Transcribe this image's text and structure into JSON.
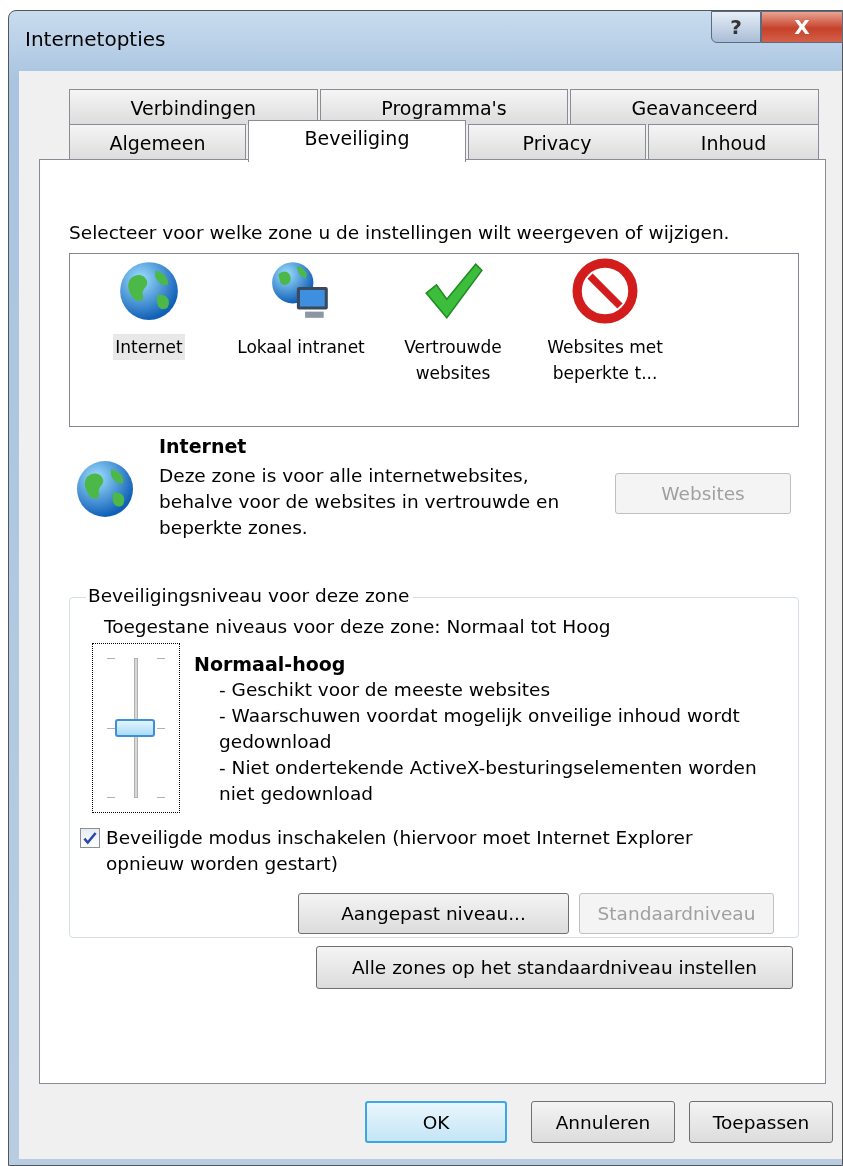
{
  "window": {
    "title": "Internetopties",
    "controls": [
      {
        "kind": "help",
        "label": "?"
      },
      {
        "kind": "close",
        "label": "X"
      }
    ]
  },
  "tabs": [
    [
      {
        "label": "Verbindingen",
        "selected": false
      },
      {
        "label": "Programma's",
        "selected": false
      },
      {
        "label": "Geavanceerd",
        "selected": false
      }
    ],
    [
      {
        "label": "Algemeen",
        "selected": false
      },
      {
        "label": "Beveiliging",
        "selected": true
      },
      {
        "label": "Privacy",
        "selected": false
      },
      {
        "label": "Inhoud",
        "selected": false
      }
    ]
  ],
  "zone_prompt": "Selecteer voor welke zone u de instellingen wilt weergeven of wijzigen.",
  "zones": [
    {
      "kind": "globe",
      "label": "Internet",
      "selected": true
    },
    {
      "kind": "intranet",
      "label": "Lokaal intranet",
      "selected": false
    },
    {
      "kind": "trusted",
      "label": "Vertrouwde websites",
      "selected": false
    },
    {
      "kind": "restricted",
      "label": "Websites met beperkte t...",
      "selected": false
    }
  ],
  "zone_info": {
    "kind": "globe",
    "title": "Internet",
    "description": "Deze zone is voor alle internetwebsites, behalve voor de websites in vertrouwde en beperkte zones.",
    "button": {
      "label": "Websites",
      "disabled": true
    }
  },
  "security_level": {
    "legend": "Beveiligingsniveau voor deze zone",
    "allowed": "Toegestane niveaus voor deze zone: Normaal tot Hoog",
    "slider": {
      "level": 0.5
    },
    "level_name": "Normaal-hoog",
    "details": [
      "- Geschikt voor de meeste websites",
      "- Waarschuwen voordat mogelijk onveilige inhoud wordt gedownload",
      "- Niet ondertekende ActiveX-besturingselementen worden niet gedownload"
    ],
    "protected_mode": {
      "label": "Beveiligde modus inschakelen (hiervoor moet Internet Explorer opnieuw worden gestart)",
      "checked": true
    },
    "buttons": [
      {
        "label": "Aangepast niveau...",
        "disabled": false
      },
      {
        "label": "Standaardniveau",
        "disabled": true
      }
    ]
  },
  "reset_button": {
    "label": "Alle zones op het standaardniveau instellen",
    "disabled": false
  },
  "dialog_buttons": [
    {
      "label": "OK",
      "default": true
    },
    {
      "label": "Annuleren",
      "default": false
    },
    {
      "label": "Toepassen",
      "default": false
    }
  ]
}
